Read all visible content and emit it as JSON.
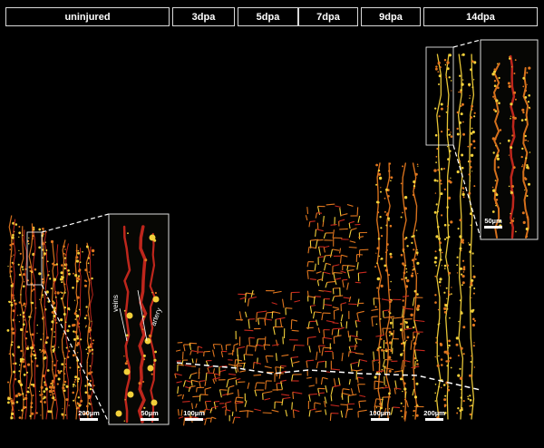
{
  "headers": [
    "uninjured",
    "3dpa",
    "5dpa",
    "7dpa",
    "9dpa",
    "14dpa"
  ],
  "scale_bars": {
    "uninjured": "200µm",
    "inset_uninjured": "50µm",
    "dpa3": "100µm",
    "dpa9": "100µm",
    "dpa14": "200µm",
    "inset_14dpa": "50µm"
  },
  "annotations": {
    "veins": "veins",
    "artery": "artery"
  },
  "colors": {
    "vessel_red": "#c8281e",
    "vessel_orange": "#e0761e",
    "vessel_yellow": "#f2d03a",
    "background": "#000000"
  }
}
